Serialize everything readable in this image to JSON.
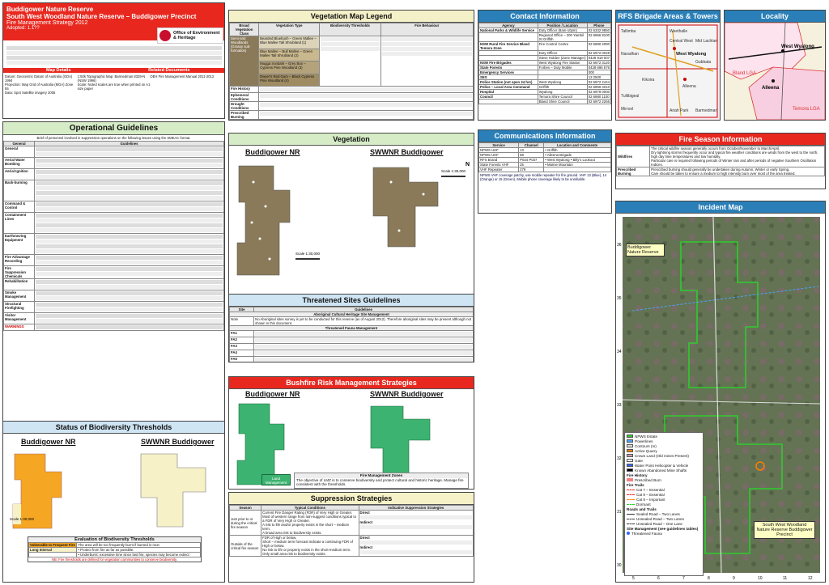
{
  "title": {
    "line1": "Buddigower Nature Reserve",
    "line2": "South West Woodland Nature Reserve – Buddigower Precinct",
    "line3": "Fire Management Strategy 2012",
    "line4": "Adopted: 1.1??",
    "publisher": "Office of Environment & Heritage",
    "publisher_sub": "NSW National Parks and Wildlife Service"
  },
  "map_details": {
    "header": "Map Details",
    "related_header": "Related Documents",
    "datum": "Datum: Geocentric Datum of Australia (GDA) 1994",
    "projection": "Projection: Map Grid of Australia (MGA) Zone 55",
    "data_sources": "Data: Spot Satellite imagery 2005",
    "topo": "1:50k Topographic Map: Barmedman 8329-N (NSW 1996)",
    "scale_note": "Scale: Noted scales are true when printed on A1 size paper",
    "related": "OEH Fire Management Manual 2011-2012",
    "version": "Version: 1",
    "date": "Date Approved:"
  },
  "veg_legend": {
    "header": "Vegetation Map Legend",
    "cols": [
      "Broad Vegetation Class",
      "Vegetation Type",
      "Biodiversity Thresholds",
      "Fire Behaviour"
    ],
    "broad": "Semi-arid Woodlands (Grassy sub-formation)",
    "types": [
      "Bearded Bluebush – Green Mallee – Blue Mallee Tall Shrubland (1)",
      "Blue Mallee – Bull Mallee – Green Mallee Tall Shrubland (2)",
      "Mugga Ironbark – Grey Box – Cypress Pine Woodland (3)",
      "Dwyer's Red Gum – Black Cypress Pine Woodland (4)"
    ],
    "rows": [
      "Fire History",
      "Ephemeral Conditions",
      "Drought Conditions",
      "Prescribed Burning"
    ]
  },
  "contact": {
    "header": "Contact Information",
    "cols": [
      "Agency",
      "Position / Location",
      "Phone"
    ],
    "rows": [
      [
        "National Parks & Wildlife Service",
        "Duty Officer (8am-10pm)",
        "02 6332 9850"
      ],
      [
        "",
        "Regional Office – 200 Yambil St Griffith",
        "02 6966 8100"
      ],
      [
        "NSW Rural Fire Service Bland Temora Zone",
        "Fire Control Centre",
        "02 6980 2090"
      ],
      [
        "",
        "Duty Officer",
        "02 6972 0028"
      ],
      [
        "",
        "Steve Holden (Zone Manager)",
        "0428 919 007"
      ],
      [
        "NSW Fire Brigades",
        "West Wyalong Fire Station",
        "02 6972 3120"
      ],
      [
        "State Forests",
        "Forbes – Duty Mobile",
        "0428 696 676"
      ],
      [
        "Emergency Services",
        "",
        "000"
      ],
      [
        "SES",
        "",
        "13 2500"
      ],
      [
        "Police Station (not open 24 hrs)",
        "West Wyalong",
        "02 6972 2444"
      ],
      [
        "Police – Local Area Command",
        "Griffith",
        "02 6969 4010"
      ],
      [
        "Hospital",
        "Wyalong",
        "02 6979 0000"
      ],
      [
        "Council",
        "Temora Shire Council",
        "02 6980 1100"
      ],
      [
        "",
        "Bland Shire Council",
        "02 6972 2266"
      ]
    ]
  },
  "rfs_map": {
    "header": "RFS Brigade Areas & Towers",
    "brigades": [
      "Tallimba",
      "Weethalle",
      "Naradhan",
      "Kikoira",
      "Tullibigeal",
      "Mirrool",
      "Alleena",
      "Ariah Park",
      "Barmedman",
      "Central West",
      "Mid Lachlan",
      "Gubbata",
      "West Wyalong"
    ]
  },
  "locality": {
    "header": "Locality",
    "places": [
      "West Wyalong",
      "Alleena",
      "Bland LGA",
      "Temora LGA"
    ],
    "road": "Newell Hwy"
  },
  "ops": {
    "header": "Operational Guidelines",
    "intro": "Brief of personnel involved in suppression operations on the following issues using the SMEAC format.",
    "col1": "General",
    "col2": "Guidelines",
    "rows": [
      "General",
      "Aerial Water Bombing",
      "Aerial Ignition",
      "Back-burning",
      "Command & Control",
      "Containment Lines",
      "Earthmoving Equipment",
      "Fire Advantage Recording",
      "Fire Suppression Chemicals",
      "Rehabilitation",
      "Smoke Management",
      "Structural Firefighting",
      "Visitor Management",
      "WARNINGS"
    ]
  },
  "vegetation": {
    "header": "Vegetation",
    "left": "Buddigower NR",
    "right": "SWWNR Buddigower",
    "scale": "Scale 1:30,000"
  },
  "threat": {
    "header": "Threatened Sites Guidelines",
    "cols": [
      "Site",
      "Guidelines"
    ],
    "sub1": "Aboriginal Cultural Heritage Site Management",
    "note_label": "Note",
    "note": "No Aboriginal sites survey is yet to be conducted for this reserve (as of August 2012). Therefore aboriginal sites may be present although not shown in this document.",
    "sub2": "Threatened Fauna Management",
    "fa": [
      "FA1",
      "FA2",
      "FA3",
      "FA4",
      "FA5"
    ]
  },
  "comms": {
    "header": "Communications Information",
    "cols": [
      "Service",
      "Channel",
      "Location and Comments"
    ],
    "rows": [
      [
        "NPWS UHF",
        "13",
        "• Griffith"
      ],
      [
        "NPWS UHF",
        "58",
        "• Alleena Brigade"
      ],
      [
        "RFS Brand",
        "P034 P037",
        "• West Wyalong • Billy's Lookout"
      ],
      [
        "State Forests VHF",
        "25",
        "• Mamie Mountain"
      ],
      [
        "VHF Repeater",
        "279",
        ""
      ]
    ],
    "note": "NPWS VHF coverage patchy, use mobile repeater for fire ground. VHF 13 (Blue), 14 (Orange) or 15 (Green). Mobile phone coverage likely to be unreliable."
  },
  "season": {
    "header": "Fire Season Information",
    "rows": [
      "Wildfires",
      "Prescribed Burning"
    ],
    "wild": [
      "The critical wildfire season generally occurs from October/November to March/April.",
      "Dry lightning storms frequently occur and typical fire weather conditions are winds from the west to the north, high day time temperatures and low humidity.",
      "Particular care is required following periods of Winter rain and after periods of negative Southern Oscillation Indices."
    ],
    "prescribed": [
      "Prescribed burning should generally be undertaken during Autumn, Winter or early Spring.",
      "Care should be taken to ensure a medium to high intensity burn over most of the area treated."
    ]
  },
  "incident": {
    "header": "Incident Map",
    "label_nr": "Buddigower Nature Reserve",
    "label_sw": "South West Woodland Nature Reserve Buddigower Precinct",
    "x_ticks": [
      "5",
      "6",
      "7",
      "8",
      "9",
      "10",
      "11",
      "12"
    ],
    "y_ticks": [
      "30",
      "31",
      "32",
      "33",
      "34",
      "35",
      "36"
    ]
  },
  "legend": {
    "items": [
      "NPWS Estate",
      "Powerlines",
      "Contours (m)",
      "Active Quarry",
      "Crown Land (Old mines Present)",
      "Gate",
      "Water Point Helicopter & Vehicle",
      "Known Abandoned Mine Shafts"
    ],
    "fire_history": "Fire History",
    "fh_items": [
      "Prescribed Burn"
    ],
    "fire_trails": "Fire Trails",
    "ft_items": [
      "Cat 7 – Essential",
      "Cat 9 – Essential",
      "Cat 9 – Important",
      "Dormant"
    ],
    "roads_header": "Roads and Trails",
    "roads": [
      "Sealed Road – Two Lanes",
      "Unsealed Road – Two Lanes",
      "Unsealed Road – One Lane"
    ],
    "site_header": "Site Management (see guidelines tables)",
    "site": [
      "Threatened Fauna"
    ]
  },
  "bushfire": {
    "header": "Bushfire Risk Management Strategies",
    "left": "Buddigower NR",
    "right": "SWWNR Buddigower",
    "zones_header": "Fire Management Zones",
    "lmz": "Land Management Zone",
    "zones_text": "The objective of LMZ is to conserve biodiversity and protect cultural and historic heritage. Manage fire consistent with the thresholds."
  },
  "suppression": {
    "header": "Suppression Strategies",
    "cols": [
      "Season",
      "Typical Conditions",
      "Indicative Suppression Strategies"
    ],
    "season1": "Just prior to or during the critical fire season",
    "season2": "Outside of the critical fire season",
    "cond1": [
      "Current Fire Danger Rating (FDR) of Very High or Greater.",
      "Most of western range from rain-suggest conditions typical to a FDR of Very High or Greater.",
      "A risk to life and/or property exists in the short – medium term.",
      "A broad area risk to biodiversity exists."
    ],
    "cond2": [
      "FDR of High or below.",
      "Short – medium term forecast indicate a continuing FDR of High or below.",
      "No risk to life or property exists in the short-medium term.",
      "Only small area risk to biodiversity exists."
    ],
    "strat": [
      "Direct",
      "Indirect",
      "Direct",
      "Indirect"
    ]
  },
  "biodiv": {
    "header": "Status of Biodiversity Thresholds",
    "left": "Buddigower NR",
    "right": "SWWNR Buddigower",
    "scale": "Scale 1:30,000",
    "eval_header": "Evaluation of Biodiversity Thresholds",
    "eval": [
      [
        "Vulnerable to Frequent Fire",
        "The area will be too frequently burnt if burned in next"
      ],
      [
        "Long Interval",
        "• Protect from fire as far as possible."
      ],
      [
        "",
        "• Underburnt: excessive time since last fire; species may become extinct"
      ]
    ],
    "eval_note": "NB: Fire thresholds are defined for vegetation communities to conserve biodiversity."
  },
  "colors": {
    "header_red": "#e8281f",
    "ops_green": "#2e8b2e",
    "contact_bg": "#2a7fb8",
    "map_bg": "#5b6b4c",
    "reserve_fill": "#8a7a5a",
    "thresh_orange": "#f5a623",
    "thresh_yellow": "#f7f1c8",
    "lmz_green": "#3cb371"
  }
}
